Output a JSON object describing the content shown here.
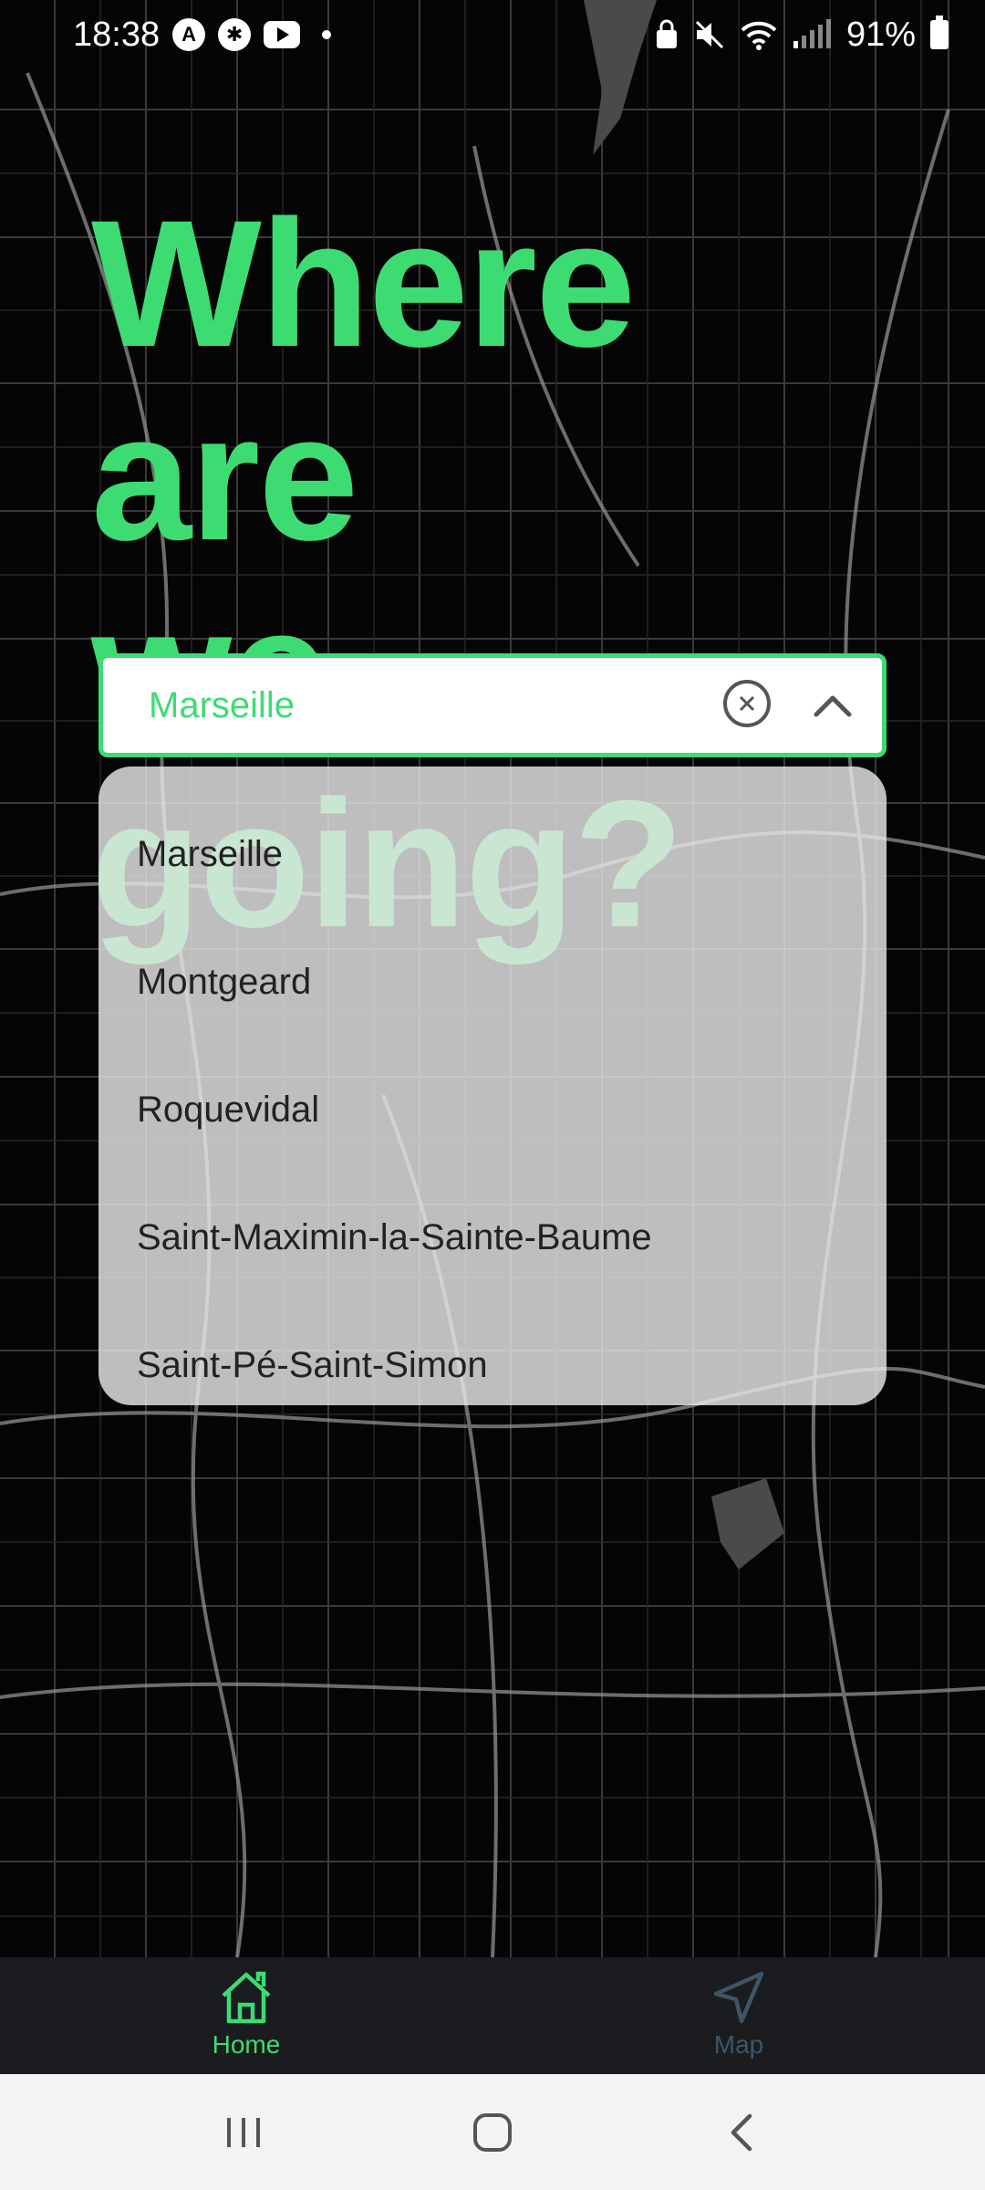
{
  "status_bar": {
    "time": "18:38",
    "left_icons": [
      "navigation-app-icon",
      "activity-icon",
      "youtube-icon",
      "notification-dot-icon"
    ],
    "right_icons": [
      "alarm-lock-icon",
      "mute-icon",
      "wifi-icon",
      "signal-icon"
    ],
    "battery": "91%"
  },
  "headline": {
    "line1": "Where are",
    "line2": "we going?",
    "color": "#3ddc73"
  },
  "search": {
    "value": "Marseille",
    "accent": "#3ddc73"
  },
  "suggestions": [
    {
      "label": "Marseille"
    },
    {
      "label": "Montgeard"
    },
    {
      "label": "Roquevidal"
    },
    {
      "label": "Saint-Maximin-la-Sainte-Baume"
    },
    {
      "label": "Saint-Pé-Saint-Simon"
    }
  ],
  "bottom_nav": {
    "items": [
      {
        "label": "Home",
        "icon": "home-icon",
        "active": true
      },
      {
        "label": "Map",
        "icon": "navigation-arrow-icon",
        "active": false
      }
    ]
  },
  "system_nav": {
    "buttons": [
      "recent-apps-icon",
      "home-circle-icon",
      "back-icon"
    ]
  }
}
